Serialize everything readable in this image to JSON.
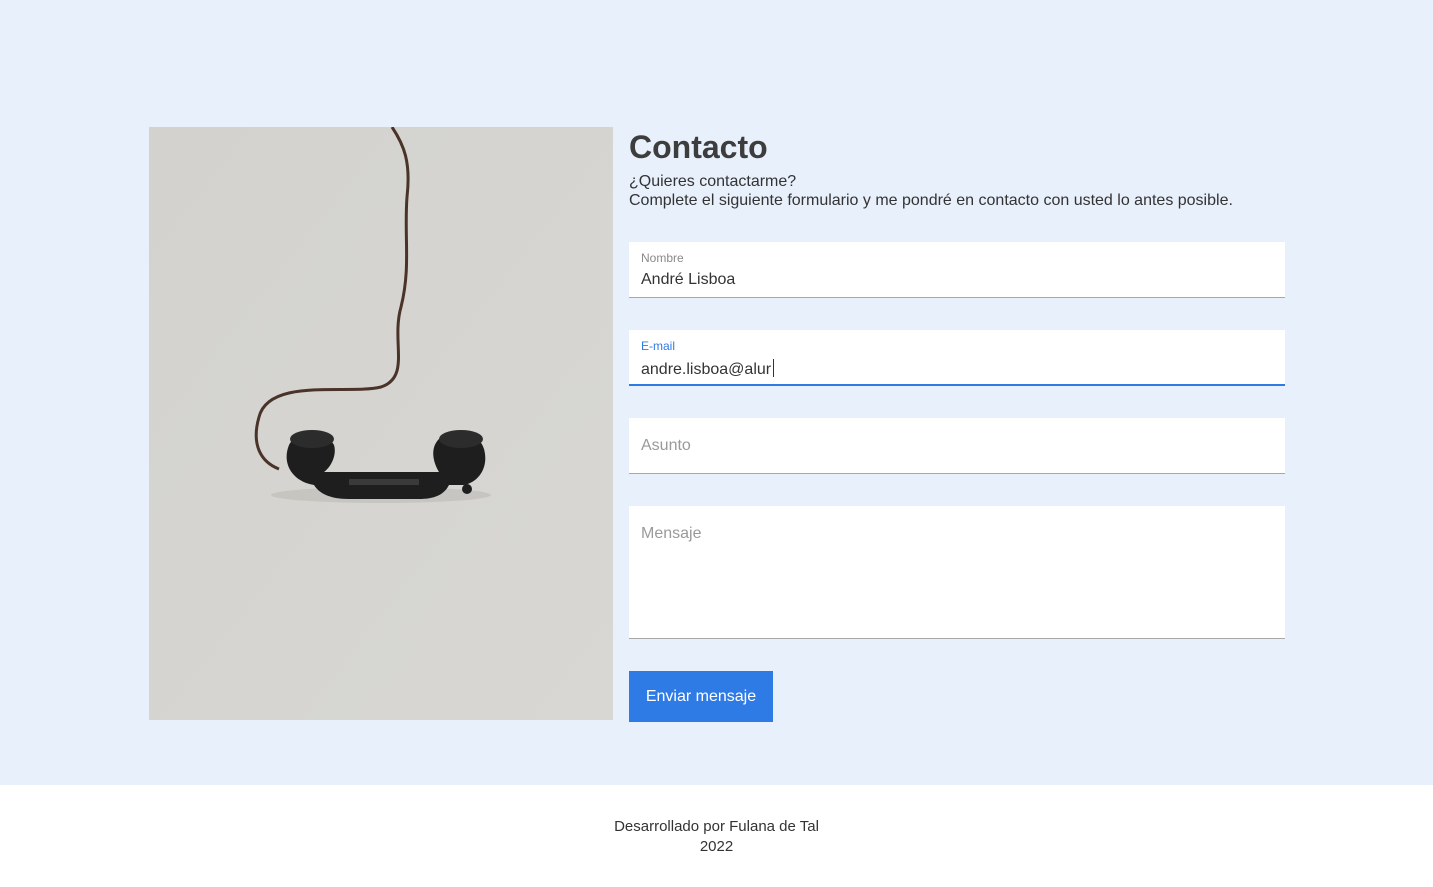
{
  "contact": {
    "title": "Contacto",
    "intro_line1": "¿Quieres contactarme?",
    "intro_line2": "Complete el siguiente formulario y me pondré en contacto con usted lo antes posible."
  },
  "form": {
    "nombre": {
      "label": "Nombre",
      "value": "André Lisboa"
    },
    "email": {
      "label": "E-mail",
      "value": "andre.lisboa@alur"
    },
    "asunto": {
      "placeholder": "Asunto"
    },
    "mensaje": {
      "placeholder": "Mensaje"
    },
    "submit_label": "Enviar mensaje"
  },
  "footer": {
    "credit": "Desarrollado por Fulana de Tal",
    "year": "2022"
  },
  "colors": {
    "page_bg": "#e8f0fc",
    "accent": "#2f7be6",
    "footer_bg": "#ffffff"
  },
  "icons": {
    "photo": "telephone-handset-image"
  }
}
